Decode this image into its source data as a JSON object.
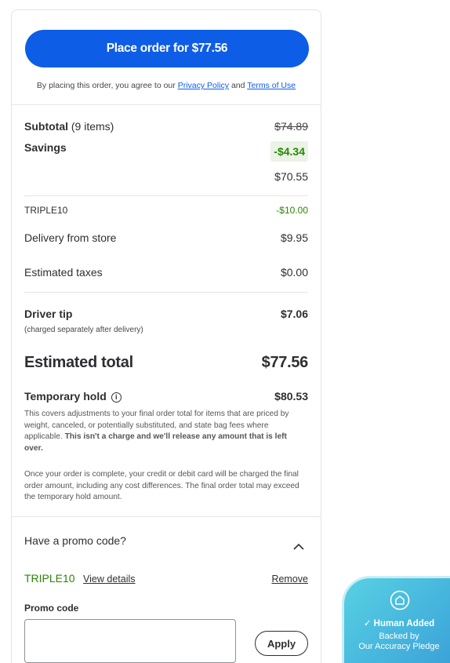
{
  "order_button": {
    "label": "Place order for $77.56"
  },
  "agreement": {
    "prefix": "By placing this order, you agree to our",
    "privacy": "Privacy Policy",
    "and": "and",
    "terms": "Terms of Use"
  },
  "summary": {
    "subtotal_label": "Subtotal",
    "subtotal_items": "(9 items)",
    "subtotal_original": "$74.89",
    "savings_label": "Savings",
    "savings_value": "-$4.34",
    "subtotal_after": "$70.55",
    "promo_code_line": "TRIPLE10",
    "promo_code_value": "-$10.00",
    "delivery_label": "Delivery from store",
    "delivery_value": "$9.95",
    "taxes_label": "Estimated taxes",
    "taxes_value": "$0.00",
    "tip_label": "Driver tip",
    "tip_value": "$7.06",
    "tip_note": "(charged separately after delivery)",
    "total_label": "Estimated total",
    "total_value": "$77.56",
    "hold_label": "Temporary hold",
    "hold_value": "$80.53",
    "hold_para1": "This covers adjustments to your final order total for items that are priced by weight, canceled, or potentially substituted, and state bag fees where applicable.",
    "hold_para1_bold": "This isn't a charge and we'll release any amount that is left over.",
    "hold_para2": "Once your order is complete, your credit or debit card will be charged the final order amount, including any cost differences. The final order total may exceed the temporary hold amount."
  },
  "promo": {
    "heading": "Have a promo code?",
    "applied_code": "TRIPLE10",
    "view_details": "View details",
    "remove": "Remove",
    "input_label": "Promo code",
    "input_value": "",
    "apply": "Apply"
  },
  "pledge": {
    "title": "Human Added",
    "line1": "Backed by",
    "line2": "Our Accuracy Pledge"
  }
}
